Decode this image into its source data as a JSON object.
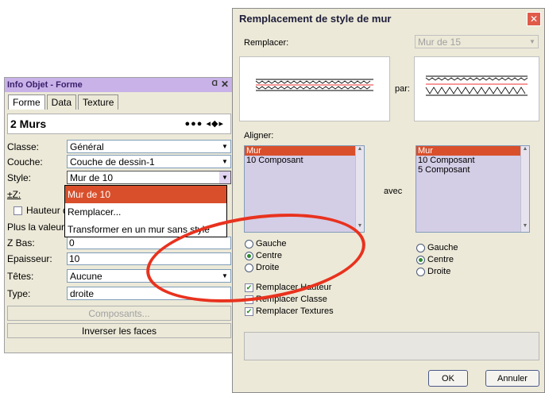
{
  "palette": {
    "title": "Info Objet - Forme",
    "pin": "Ɑ",
    "close": "✕",
    "tabs": [
      "Forme",
      "Data",
      "Texture"
    ],
    "object_count": "2 Murs",
    "nav": "●●● ◂◆▸",
    "classe_label": "Classe:",
    "classe_value": "Général",
    "couche_label": "Couche:",
    "couche_value": "Couche de dessin-1",
    "style_label": "Style:",
    "style_value": "Mur de 10",
    "z_label": "±Z:",
    "hauteur_label": "Hauteur d",
    "plus_label": "Plus la valeur:",
    "zbas_label": "Z Bas:",
    "zbas_value": "0",
    "epaisseur_label": "Epaisseur:",
    "epaisseur_value": "10",
    "tetes_label": "Têtes:",
    "tetes_value": "Aucune",
    "type_label": "Type:",
    "type_value": "droite",
    "composants_button": "Composants...",
    "inverser_button": "Inverser les faces",
    "style_menu": [
      "Mur de 10",
      "Remplacer...",
      "Transformer en un mur sans style"
    ]
  },
  "dialog": {
    "title": "Remplacement de style de mur",
    "close": "✕",
    "remplacer_label": "Remplacer:",
    "target_style": "Mur de 15",
    "par_label": "par:",
    "aligner_label": "Aligner:",
    "left_list": [
      "Mur",
      "10 Composant"
    ],
    "avec_label": "avec",
    "right_list": [
      "Mur",
      "10 Composant",
      "5 Composant"
    ],
    "left_radios": [
      "Gauche",
      "Centre",
      "Droite"
    ],
    "right_radios": [
      "Gauche",
      "Centre",
      "Droite"
    ],
    "checkbox_hauteur": "Remplacer Hauteur",
    "checkbox_classe": "Remplacer Classe",
    "checkbox_textures": "Remplacer Textures",
    "ok": "OK",
    "cancel": "Annuler"
  },
  "colors": {
    "selection": "#d94f2b",
    "annotation": "#e8321e",
    "palette_title": "#c8b2e8"
  }
}
